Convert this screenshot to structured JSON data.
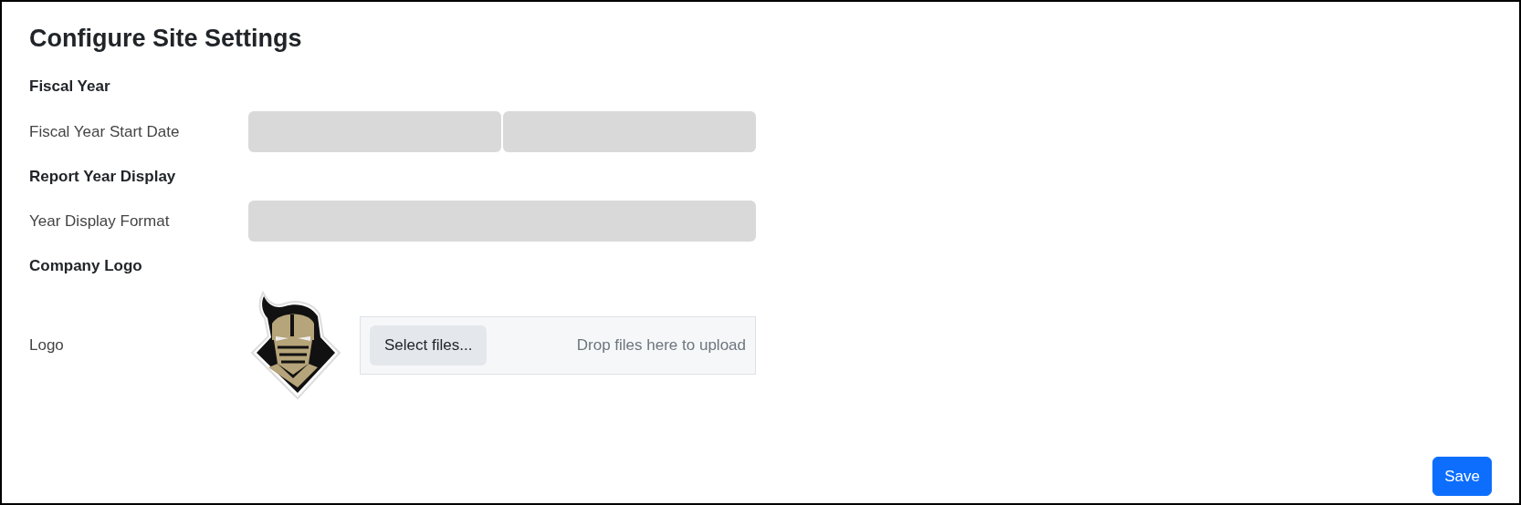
{
  "title": "Configure Site Settings",
  "sections": [
    {
      "heading": "Fiscal Year",
      "rows": [
        {
          "label": "Fiscal Year Start Date",
          "kind": "skeleton",
          "fields": [
            {
              "kind": "skeleton"
            },
            {
              "kind": "skeleton"
            }
          ]
        }
      ]
    },
    {
      "heading": "Report Year Display",
      "rows": [
        {
          "label": "Year Display Format",
          "kind": "skeleton",
          "fields": [
            {
              "kind": "skeleton"
            }
          ]
        }
      ]
    },
    {
      "heading": "Company Logo",
      "rows": [
        {
          "label": "Logo",
          "kind": "upload",
          "button": "Select files...",
          "hint": "Drop files here to upload"
        }
      ]
    }
  ],
  "save_button": "Save"
}
